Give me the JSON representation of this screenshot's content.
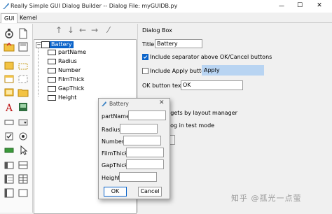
{
  "window": {
    "title": "Really Simple GUI Dialog Builder -- Dialog File: myGUIDB.py",
    "controls": {
      "minimize": "—",
      "maximize": "☐",
      "close": "✕"
    }
  },
  "tabs": [
    {
      "label": "GUI",
      "active": true
    },
    {
      "label": "Kernel",
      "active": false
    }
  ],
  "toolbar_arrows": [
    "↑",
    "↓",
    "←",
    "→",
    "⁄"
  ],
  "tree": {
    "root": "Battery",
    "children": [
      "partName",
      "Radius",
      "Number",
      "FilmThick",
      "GapThick",
      "Height"
    ]
  },
  "dialog_box": {
    "section_label": "Dialog Box",
    "title_label": "Title:",
    "title_value": "Battery",
    "separator_label": "Include separator above OK/Cancel buttons",
    "separator_checked": true,
    "apply_label": "Include Apply button:",
    "apply_checked": false,
    "apply_value": "Apply",
    "ok_label": "OK button text:",
    "ok_value": "OK",
    "layout_label": "idgets by layout manager",
    "test_mode_label": "alog in test mode",
    "partial_text": "g"
  },
  "floating_dialog": {
    "title": "Battery",
    "close": "✕",
    "fields": [
      "partName",
      "Radius",
      "Number",
      "FilmThick",
      "GapThick",
      "Height"
    ],
    "ok_button": "OK",
    "cancel_button": "Cancel"
  },
  "watermark": "知乎 @孤光一点萤",
  "colors": {
    "accent": "#0a63c9",
    "highlight": "#b8d4f2",
    "tree_select": "#0a63c9"
  }
}
